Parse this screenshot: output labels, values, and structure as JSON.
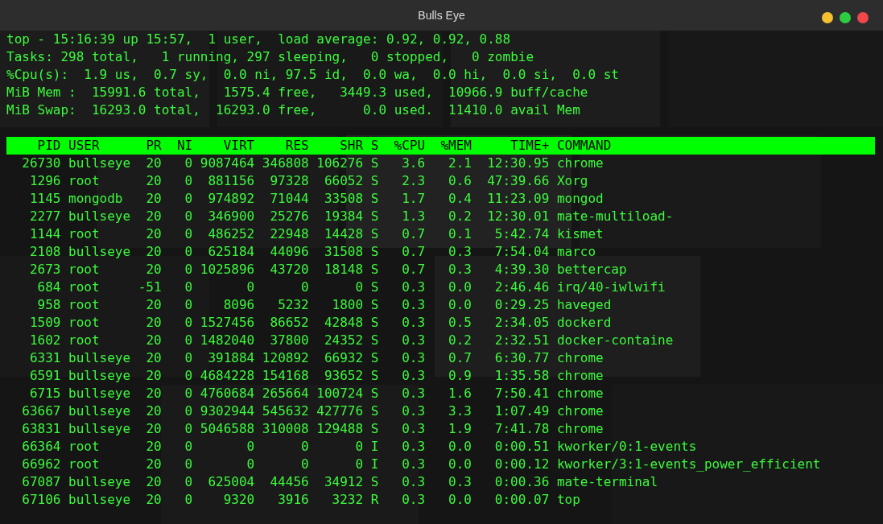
{
  "window": {
    "title": "Bulls Eye"
  },
  "summary_lines": [
    "top - 15:16:39 up 15:57,  1 user,  load average: 0.92, 0.92, 0.88",
    "Tasks: 298 total,   1 running, 297 sleeping,   0 stopped,   0 zombie",
    "%Cpu(s):  1.9 us,  0.7 sy,  0.0 ni, 97.5 id,  0.0 wa,  0.0 hi,  0.0 si,  0.0 st",
    "MiB Mem :  15991.6 total,   1575.4 free,   3449.3 used,  10966.9 buff/cache",
    "MiB Swap:  16293.0 total,  16293.0 free,      0.0 used.  11410.0 avail Mem"
  ],
  "table": {
    "columns": [
      "PID",
      "USER",
      "PR",
      "NI",
      "VIRT",
      "RES",
      "SHR",
      "S",
      "%CPU",
      "%MEM",
      "TIME+",
      "COMMAND"
    ],
    "rows": [
      [
        "26730",
        "bullseye",
        "20",
        "0",
        "9087464",
        "346808",
        "106276",
        "S",
        "3.6",
        "2.1",
        "12:30.95",
        "chrome"
      ],
      [
        "1296",
        "root",
        "20",
        "0",
        "881156",
        "97328",
        "66052",
        "S",
        "2.3",
        "0.6",
        "47:39.66",
        "Xorg"
      ],
      [
        "1145",
        "mongodb",
        "20",
        "0",
        "974892",
        "71044",
        "33508",
        "S",
        "1.7",
        "0.4",
        "11:23.09",
        "mongod"
      ],
      [
        "2277",
        "bullseye",
        "20",
        "0",
        "346900",
        "25276",
        "19384",
        "S",
        "1.3",
        "0.2",
        "12:30.01",
        "mate-multiload-"
      ],
      [
        "1144",
        "root",
        "20",
        "0",
        "486252",
        "22948",
        "14428",
        "S",
        "0.7",
        "0.1",
        "5:42.74",
        "kismet"
      ],
      [
        "2108",
        "bullseye",
        "20",
        "0",
        "625184",
        "44096",
        "31508",
        "S",
        "0.7",
        "0.3",
        "7:54.04",
        "marco"
      ],
      [
        "2673",
        "root",
        "20",
        "0",
        "1025896",
        "43720",
        "18148",
        "S",
        "0.7",
        "0.3",
        "4:39.30",
        "bettercap"
      ],
      [
        "684",
        "root",
        "-51",
        "0",
        "0",
        "0",
        "0",
        "S",
        "0.3",
        "0.0",
        "2:46.46",
        "irq/40-iwlwifi"
      ],
      [
        "958",
        "root",
        "20",
        "0",
        "8096",
        "5232",
        "1800",
        "S",
        "0.3",
        "0.0",
        "0:29.25",
        "haveged"
      ],
      [
        "1509",
        "root",
        "20",
        "0",
        "1527456",
        "86652",
        "42848",
        "S",
        "0.3",
        "0.5",
        "2:34.05",
        "dockerd"
      ],
      [
        "1602",
        "root",
        "20",
        "0",
        "1482040",
        "37800",
        "24352",
        "S",
        "0.3",
        "0.2",
        "2:32.51",
        "docker-containe"
      ],
      [
        "6331",
        "bullseye",
        "20",
        "0",
        "391884",
        "120892",
        "66932",
        "S",
        "0.3",
        "0.7",
        "6:30.77",
        "chrome"
      ],
      [
        "6591",
        "bullseye",
        "20",
        "0",
        "4684228",
        "154168",
        "93652",
        "S",
        "0.3",
        "0.9",
        "1:35.58",
        "chrome"
      ],
      [
        "6715",
        "bullseye",
        "20",
        "0",
        "4760684",
        "265664",
        "100724",
        "S",
        "0.3",
        "1.6",
        "7:50.41",
        "chrome"
      ],
      [
        "63667",
        "bullseye",
        "20",
        "0",
        "9302944",
        "545632",
        "427776",
        "S",
        "0.3",
        "3.3",
        "1:07.49",
        "chrome"
      ],
      [
        "63831",
        "bullseye",
        "20",
        "0",
        "5046588",
        "310008",
        "129488",
        "S",
        "0.3",
        "1.9",
        "7:41.78",
        "chrome"
      ],
      [
        "66364",
        "root",
        "20",
        "0",
        "0",
        "0",
        "0",
        "I",
        "0.3",
        "0.0",
        "0:00.51",
        "kworker/0:1-events"
      ],
      [
        "66962",
        "root",
        "20",
        "0",
        "0",
        "0",
        "0",
        "I",
        "0.3",
        "0.0",
        "0:00.12",
        "kworker/3:1-events_power_efficient"
      ],
      [
        "67087",
        "bullseye",
        "20",
        "0",
        "625004",
        "44456",
        "34912",
        "S",
        "0.3",
        "0.3",
        "0:00.36",
        "mate-terminal"
      ],
      [
        "67106",
        "bullseye",
        "20",
        "0",
        "9320",
        "3916",
        "3232",
        "R",
        "0.3",
        "0.0",
        "0:00.07",
        "top"
      ]
    ]
  }
}
